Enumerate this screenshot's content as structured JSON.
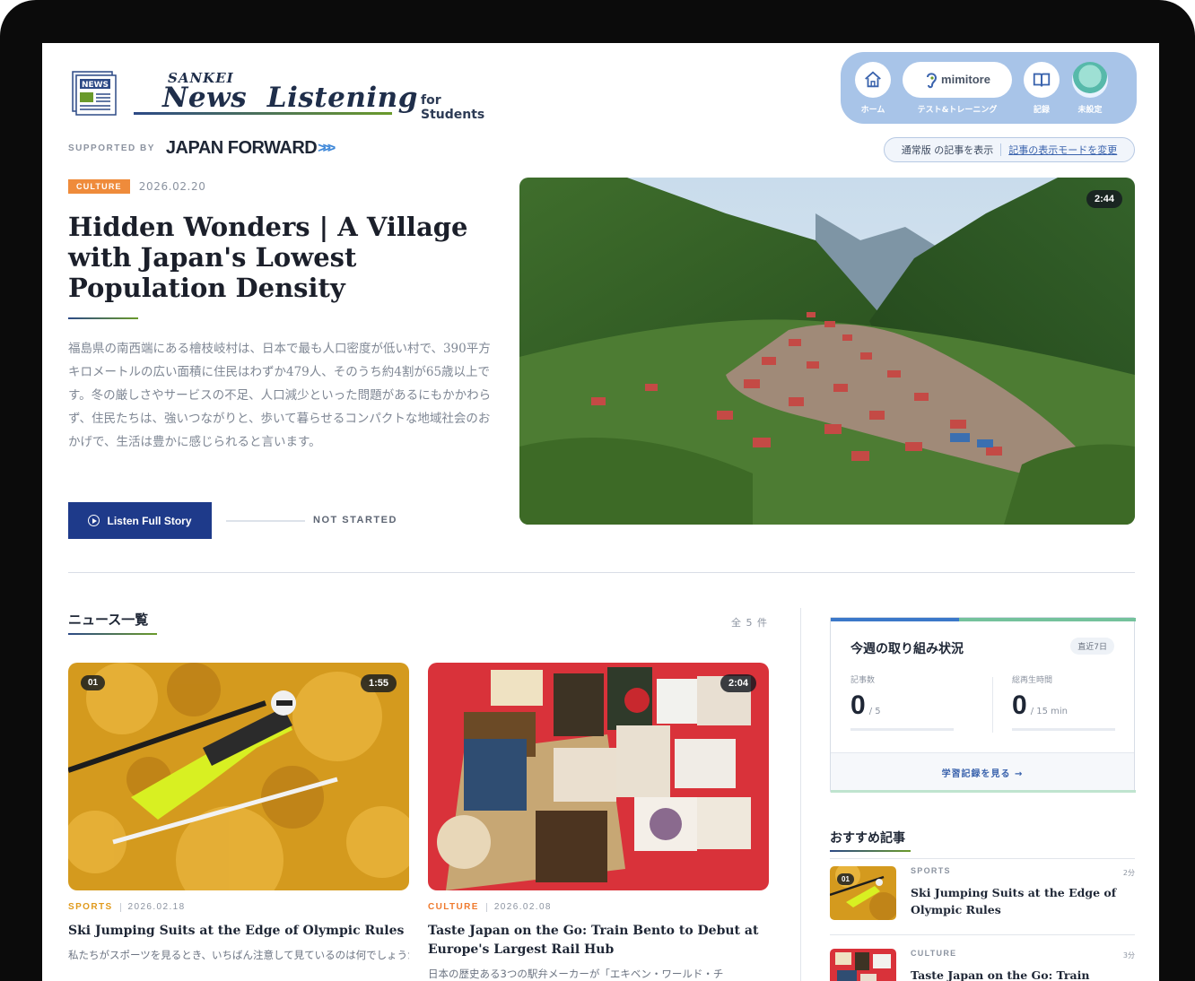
{
  "brand": {
    "logo_badge": "NEWS",
    "sankei": "SANKEI",
    "title": "News  Listening",
    "subtitle": "for Students",
    "supported_by": "SUPPORTED BY",
    "partner": "JAPAN FORWARD",
    "partner_arrows": ">>>"
  },
  "nav": {
    "items": [
      {
        "label": "ホーム",
        "icon": "home-icon"
      },
      {
        "label": "テスト&トレーニング",
        "pill_text": "mimitore",
        "icon": "ear-icon"
      },
      {
        "label": "記録",
        "icon": "book-icon"
      },
      {
        "label": "未設定",
        "icon": "avatar-icon"
      }
    ]
  },
  "mode": {
    "current": "通常版 の記事を表示",
    "link": "記事の表示モードを変更"
  },
  "hero": {
    "tag": "CULTURE",
    "date": "2026.02.20",
    "title": "Hidden Wonders | A Village with Japan's Lowest Population Density",
    "summary": "福島県の南西端にある檜枝岐村は、日本で最も人口密度が低い村で、390平方キロメートルの広い面積に住民はわずか479人、そのうち約4割が65歳以上です。冬の厳しさやサービスの不足、人口減少といった問題があるにもかかわらず、住民たちは、強いつながりと、歩いて暮らせるコンパクトな地域社会のおかげで、生活は豊かに感じられると言います。",
    "duration": "2:44",
    "listen_label": "Listen Full Story",
    "status": "NOT STARTED",
    "progress": 0
  },
  "news": {
    "heading": "ニュース一覧",
    "count": "全 5 件",
    "cards": [
      {
        "number": "01",
        "duration": "1:55",
        "category": "SPORTS",
        "date": "2026.02.18",
        "title": "Ski Jumping Suits at the Edge of Olympic Rules",
        "summary": "私たちがスポーツを見るとき、いちばん注意して見ているのは何でしょうか。スキージャンプでは、おそらくまず、ジャンプの…"
      },
      {
        "number": "",
        "duration": "2:04",
        "category": "CULTURE",
        "date": "2026.02.08",
        "title": "Taste Japan on the Go: Train Bento to Debut at Europe's Largest Rail Hub",
        "summary": "日本の歴史ある3つの駅弁メーカーが「エキベン・ワールド・チ"
      }
    ]
  },
  "weekly": {
    "title": "今週の取り組み状況",
    "range": "直近7日",
    "articles_label": "記事数",
    "articles_value": "0",
    "articles_unit": "/ 5",
    "articles_progress": 0,
    "time_label": "総再生時間",
    "time_value": "0",
    "time_unit": "/ 15 min",
    "time_progress": 0,
    "footer_link": "学習記録を見る →"
  },
  "recommended": {
    "heading": "おすすめ記事",
    "items": [
      {
        "number": "01",
        "category": "SPORTS",
        "time": "2分",
        "title": "Ski Jumping Suits at the Edge of Olympic Rules"
      },
      {
        "category": "CULTURE",
        "time": "3分",
        "title": "Taste Japan on the Go: Train Bento to Debut at Europe's Largest Rail Hub"
      }
    ]
  }
}
